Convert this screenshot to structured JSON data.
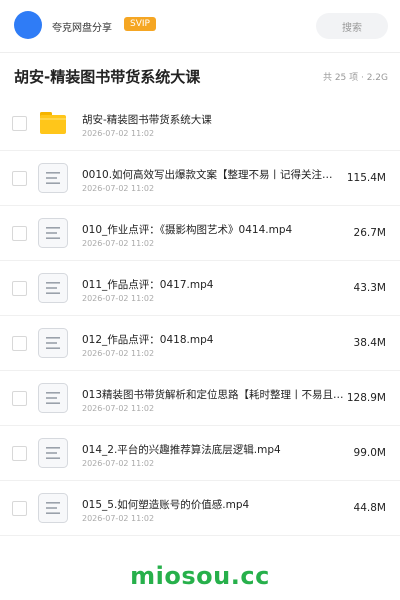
{
  "header": {
    "app_name": "夸克网盘分享",
    "badge": "SVIP",
    "search_placeholder": "搜索"
  },
  "folder": {
    "title": "胡安-精装图书带货系统大课",
    "meta": "共 25 项 · 2.2G"
  },
  "files": [
    {
      "name": "胡安-精装图书带货系统大课",
      "date": "2026-07-02 11:02",
      "size": "",
      "type": "folder"
    },
    {
      "name": "0010.如何高效写出爆款文案【整理不易丨记得关注…",
      "date": "2026-07-02 11:02",
      "size": "115.4M",
      "type": "file"
    },
    {
      "name": "010_作业点评：《摄影构图艺术》0414.mp4",
      "date": "2026-07-02 11:02",
      "size": "26.7M",
      "type": "file"
    },
    {
      "name": "011_作品点评：0417.mp4",
      "date": "2026-07-02 11:02",
      "size": "43.3M",
      "type": "file"
    },
    {
      "name": "012_作品点评：0418.mp4",
      "date": "2026-07-02 11:02",
      "size": "38.4M",
      "type": "file"
    },
    {
      "name": "013精装图书带货解析和定位思路【耗时整理丨不易且…",
      "date": "2026-07-02 11:02",
      "size": "128.9M",
      "type": "file"
    },
    {
      "name": "014_2.平台的兴趣推荐算法底层逻辑.mp4",
      "date": "2026-07-02 11:02",
      "size": "99.0M",
      "type": "file"
    },
    {
      "name": "015_5.如何塑造账号的价值感.mp4",
      "date": "2026-07-02 11:02",
      "size": "44.8M",
      "type": "file"
    }
  ],
  "watermark": "miosou.cc",
  "colors": {
    "accent": "#2f7cf6",
    "svip": "#f5a623",
    "folder": "#ffc61a",
    "watermark": "#27b04b"
  }
}
